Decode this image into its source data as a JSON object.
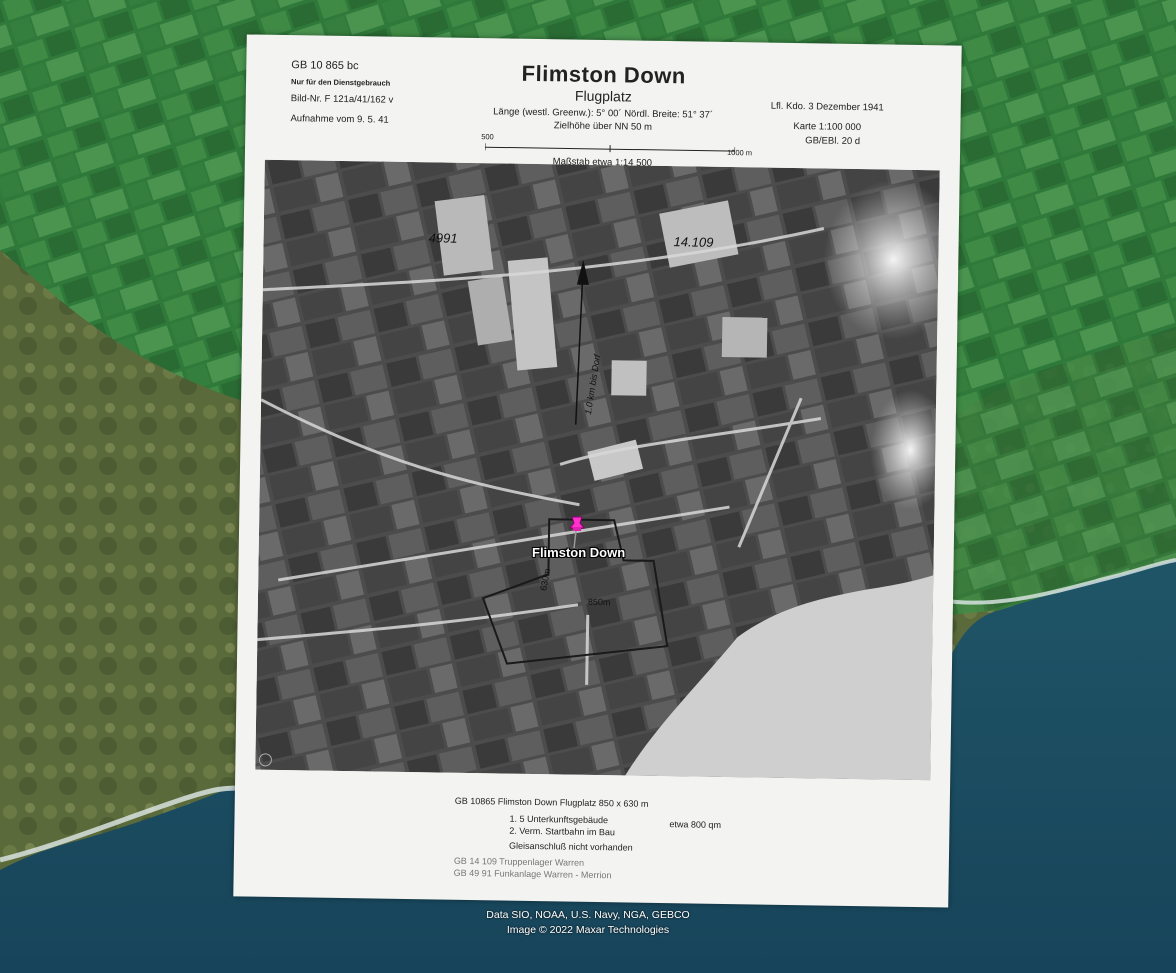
{
  "sheet": {
    "ref_top": "GB 10 865 bc",
    "restricted": "Nur für den Dienstgebrauch",
    "bild_nr": "Bild-Nr. F 121a/41/162 v",
    "aufnahme": "Aufnahme vom 9. 5. 41",
    "title": "Flimston Down",
    "subtitle": "Flugplatz",
    "coords": "Länge (westl. Greenw.): 5° 00´     Nördl. Breite: 51° 37´",
    "zielhoehe": "Zielhöhe über NN 50 m",
    "scale_left": "500",
    "scale_right": "1000 m",
    "scale_text": "Maßstab etwa 1:14 500",
    "lfl": "Lfl. Kdo. 3     Dezember 1941",
    "karte": "Karte 1:100 000",
    "ebl": "GB/EBl. 20 d"
  },
  "photo_annotations": {
    "num_4991": "4991",
    "num_14109": "14.109",
    "arrow_text": "1.0 km bis Dorf",
    "dim_630": "630m",
    "dim_850": "850m"
  },
  "legend": {
    "line1": "GB 10865  Flimston Down   Flugplatz 850 x 630 m",
    "line2": "1. 5 Unterkunftsgebäude",
    "line2b": "etwa  800 qm",
    "line3": "2. Verm. Startbahn im Bau",
    "line4": "Gleisanschluß  nicht  vorhanden",
    "line5": "GB  14 109   Truppenlager Warren",
    "line6": "GB  49 91    Funkanlage Warren - Merrion"
  },
  "map": {
    "placemark_label": "Flimston Down",
    "placemark_icon": "pink-pushpin-icon",
    "attribution_1": "Data SIO, NOAA, U.S. Navy, NGA, GEBCO",
    "attribution_2": "Image © 2022 Maxar Technologies"
  }
}
